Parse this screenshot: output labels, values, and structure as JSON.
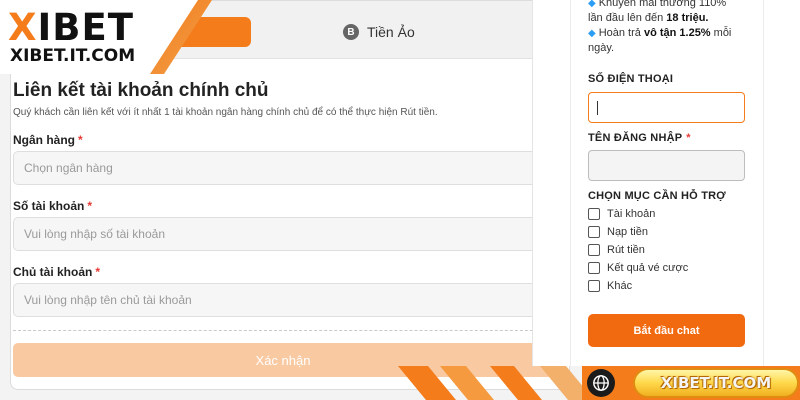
{
  "logo": {
    "brand_x": "X",
    "brand_rest": "IBET",
    "url": "XIBET.IT.COM"
  },
  "tabs": {
    "crypto_label": "Tiền Ảo",
    "crypto_symbol": "B"
  },
  "form": {
    "title": "Liên kết tài khoản chính chủ",
    "description": "Quý khách cần liên kết với ít nhất 1 tài khoản ngân hàng chính chủ để có thể thực hiện Rút tiền.",
    "required_mark": "*",
    "bank_label": "Ngân hàng",
    "bank_placeholder": "Chọn ngân hàng",
    "account_number_label": "Số tài khoản",
    "account_number_placeholder": "Vui lòng nhập số tài khoản",
    "account_holder_label": "Chủ tài khoản",
    "account_holder_placeholder": "Vui lòng nhập tên chủ tài khoản",
    "confirm_label": "Xác nhận"
  },
  "chat": {
    "promo_line1_prefix": "Khuyến mãi thưởng 110%",
    "promo_line2_prefix": "lần đầu lên đến ",
    "promo_line2_bold": "18 triệu.",
    "promo_line3_prefix": "Hoàn trả ",
    "promo_line3_bold": "vô tận 1.25%",
    "promo_line3_suffix": " mỗi",
    "promo_line4": "ngày.",
    "phone_label": "SỐ ĐIỆN THOẠI",
    "username_label": "TÊN ĐĂNG NHẬP",
    "required_mark": "*",
    "support_label": "CHỌN MỤC CẦN HỖ TRỢ",
    "support_options": [
      "Tài khoản",
      "Nạp tiền",
      "Rút tiền",
      "Kết quả vé cược",
      "Khác"
    ],
    "start_label": "Bắt đầu chat"
  },
  "bottom": {
    "site_label": "XIBET.IT.COM"
  },
  "colors": {
    "accent": "#f47c1b",
    "confirm_disabled": "#f9c9a1",
    "start_button": "#f26a10",
    "required": "#e53935"
  }
}
